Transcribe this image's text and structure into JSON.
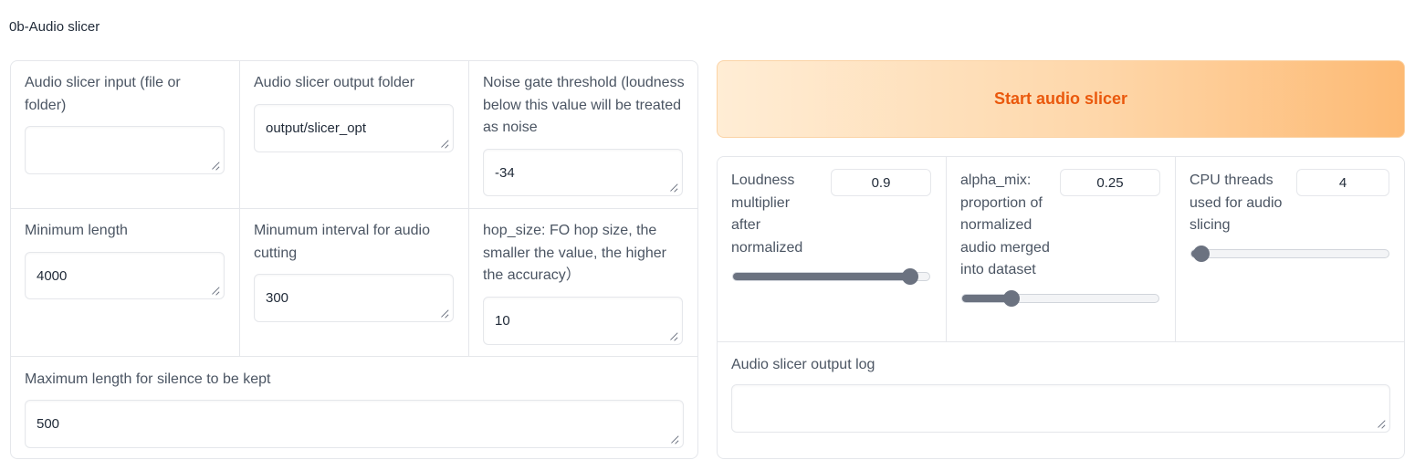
{
  "section": {
    "title": "0b-Audio slicer"
  },
  "left": {
    "input": {
      "label": "Audio slicer input (file or folder)",
      "value": ""
    },
    "output_folder": {
      "label": "Audio slicer output folder",
      "value": "output/slicer_opt"
    },
    "noise_gate": {
      "label": "Noise gate threshold (loudness below this value will be treated as noise",
      "value": "-34"
    },
    "min_length": {
      "label": "Minimum length",
      "value": "4000"
    },
    "min_interval": {
      "label": "Minumum interval for audio cutting",
      "value": "300"
    },
    "hop_size": {
      "label": "hop_size: FO hop size, the smaller the value, the higher the accuracy）",
      "value": "10"
    },
    "max_silence": {
      "label": "Maximum length for silence to be kept",
      "value": "500"
    }
  },
  "right": {
    "start_button": {
      "label": "Start audio slicer"
    },
    "loudness": {
      "label": "Loudness multiplier after normalized",
      "value": "0.9",
      "min": 0,
      "max": 1,
      "fraction": 0.9
    },
    "alpha_mix": {
      "label": "alpha_mix: proportion of normalized audio merged into dataset",
      "value": "0.25",
      "min": 0,
      "max": 1,
      "fraction": 0.25
    },
    "cpu_threads": {
      "label": "CPU threads used for audio slicing",
      "value": "4",
      "fraction": 0.05
    },
    "output_log": {
      "label": "Audio slicer output log",
      "value": ""
    }
  }
}
